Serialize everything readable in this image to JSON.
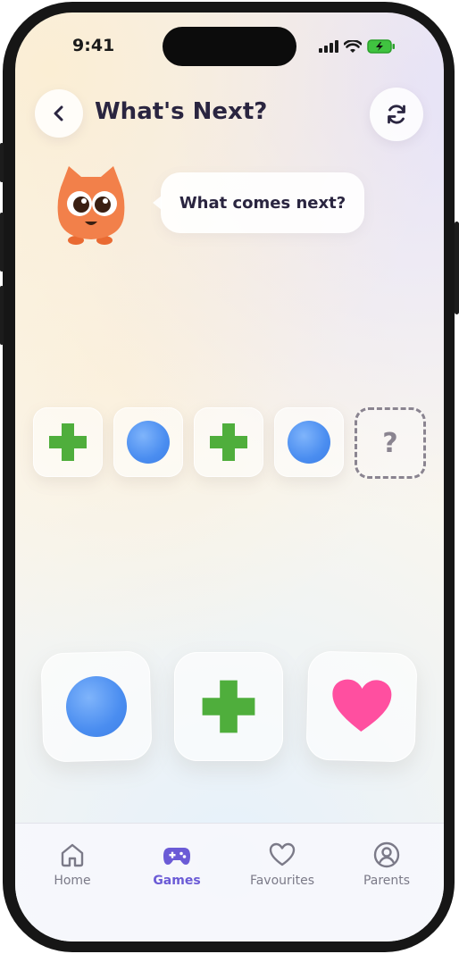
{
  "status_bar": {
    "time": "9:41"
  },
  "header": {
    "title": "What's Next?"
  },
  "mascot": {
    "speech": "What comes next?"
  },
  "sequence": {
    "items": [
      "plus-icon",
      "circle-icon",
      "plus-icon",
      "circle-icon"
    ],
    "missing_label": "?"
  },
  "choices": [
    "circle-icon",
    "plus-icon",
    "heart-icon"
  ],
  "colors": {
    "accent": "#6b5bd6",
    "green": "#4fae3c",
    "blue": "#4a8df0",
    "pink": "#ff4fa0",
    "mascot": "#f2804a"
  },
  "nav": {
    "items": [
      {
        "label": "Home",
        "icon": "home-icon"
      },
      {
        "label": "Games",
        "icon": "gamepad-icon",
        "active": true
      },
      {
        "label": "Favourites",
        "icon": "heart-outline-icon"
      },
      {
        "label": "Parents",
        "icon": "user-circle-icon"
      }
    ]
  }
}
